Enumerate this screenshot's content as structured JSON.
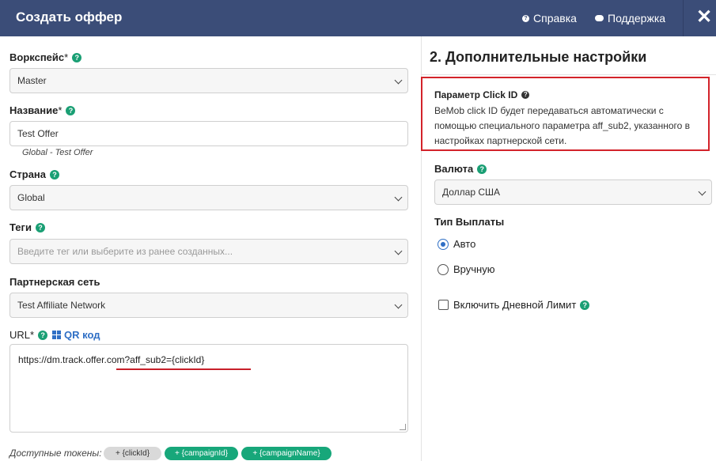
{
  "header": {
    "title": "Создать оффер",
    "help_label": "Справка",
    "support_label": "Поддержка",
    "close_symbol": "✕"
  },
  "form": {
    "workspace": {
      "label": "Воркспейс",
      "required_mark": "*",
      "value": "Master"
    },
    "name": {
      "label": "Название",
      "required_mark": "*",
      "value": "Test Offer",
      "hint": "Global - Test Offer"
    },
    "country": {
      "label": "Страна",
      "value": "Global"
    },
    "tags": {
      "label": "Теги",
      "placeholder": "Введите тег или выберите из ранее созданных..."
    },
    "network": {
      "label": "Партнерская сеть",
      "value": "Test Affiliate Network"
    },
    "url": {
      "label": "URL",
      "required_mark": "*",
      "qr_label": "QR код",
      "value": "https://dm.track.offer.com?aff_sub2={clickId}"
    },
    "tokens": {
      "label": "Доступные токены:",
      "items": [
        "+ {clickId}",
        "+ {campaignId}",
        "+ {campaignName}"
      ]
    }
  },
  "additional": {
    "title": "2. Дополнительные настройки",
    "click_id": {
      "title": "Параметр Click ID",
      "text": "BeMob click ID будет передаваться автоматически с помощью специального параметра aff_sub2, указанного в настройках партнерской сети."
    },
    "currency": {
      "label": "Валюта",
      "value": "Доллар США"
    },
    "payout": {
      "label": "Тип Выплаты",
      "options": [
        "Авто",
        "Вручную"
      ],
      "selected": "Авто"
    },
    "daily_limit": {
      "label": "Включить Дневной Лимит",
      "checked": false
    }
  },
  "colors": {
    "header_bg": "#3b4d78",
    "help_icon": "#1a9f74",
    "link": "#2f6fc5",
    "highlight": "#d3232a",
    "token_green": "#17a77a"
  },
  "icons": {
    "help": "question-circle-icon",
    "support": "chat-bubble-icon",
    "close": "close-icon",
    "qr": "qr-code-icon",
    "dropdown": "chevron-down-icon"
  }
}
